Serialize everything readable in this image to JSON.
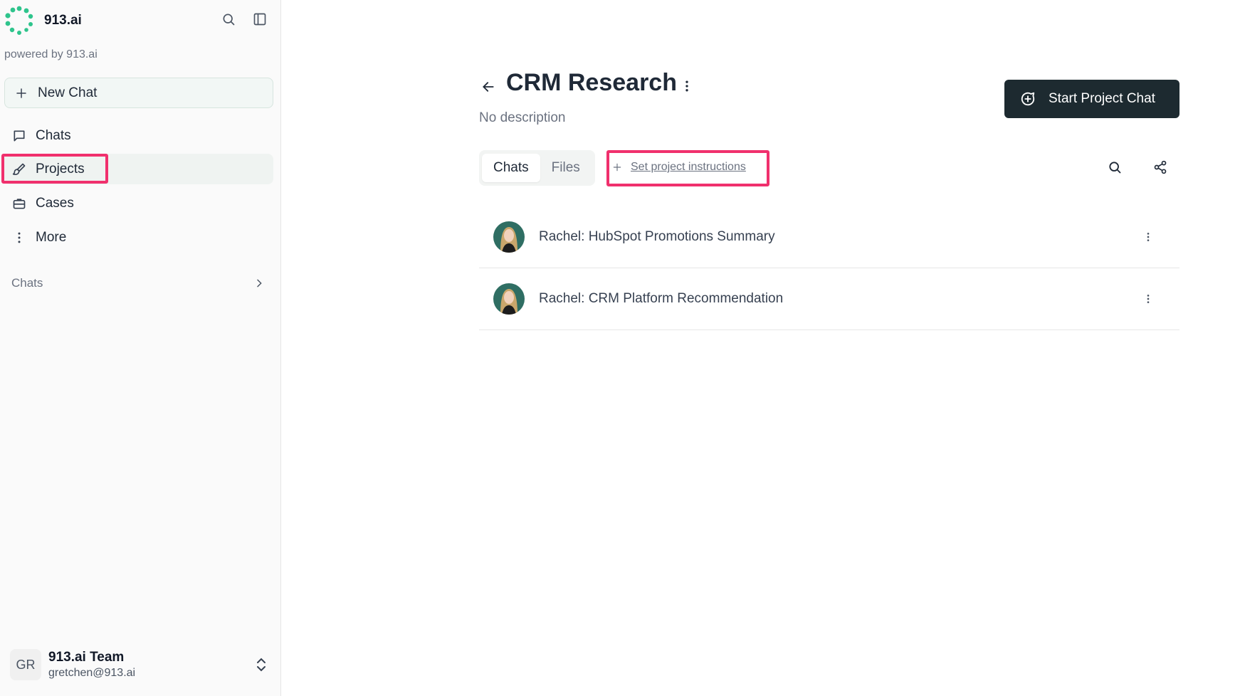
{
  "brand": {
    "name": "913.ai",
    "powered_by": "powered by 913.ai",
    "accent": "#2ec48c"
  },
  "sidebar": {
    "new_chat": "New Chat",
    "items": [
      {
        "label": "Chats",
        "icon": "message-square-icon"
      },
      {
        "label": "Projects",
        "icon": "brush-icon",
        "active": true
      },
      {
        "label": "Cases",
        "icon": "briefcase-icon"
      },
      {
        "label": "More",
        "icon": "more-vertical-icon"
      }
    ],
    "section": {
      "label": "Chats",
      "icon": "chevron-right-icon"
    },
    "user": {
      "initials": "GR",
      "name": "913.ai Team",
      "email": "gretchen@913.ai"
    }
  },
  "project": {
    "title": "CRM Research",
    "description": "No description",
    "start_button": "Start Project Chat",
    "tabs": [
      {
        "label": "Chats",
        "active": true
      },
      {
        "label": "Files",
        "active": false
      }
    ],
    "instructions_link": "Set project instructions",
    "chats": [
      {
        "title": "Rachel: HubSpot Promotions Summary"
      },
      {
        "title": "Rachel: CRM Platform Recommendation"
      }
    ]
  },
  "colors": {
    "highlight": "#f0306d",
    "primary_button": "#1d2a30"
  }
}
